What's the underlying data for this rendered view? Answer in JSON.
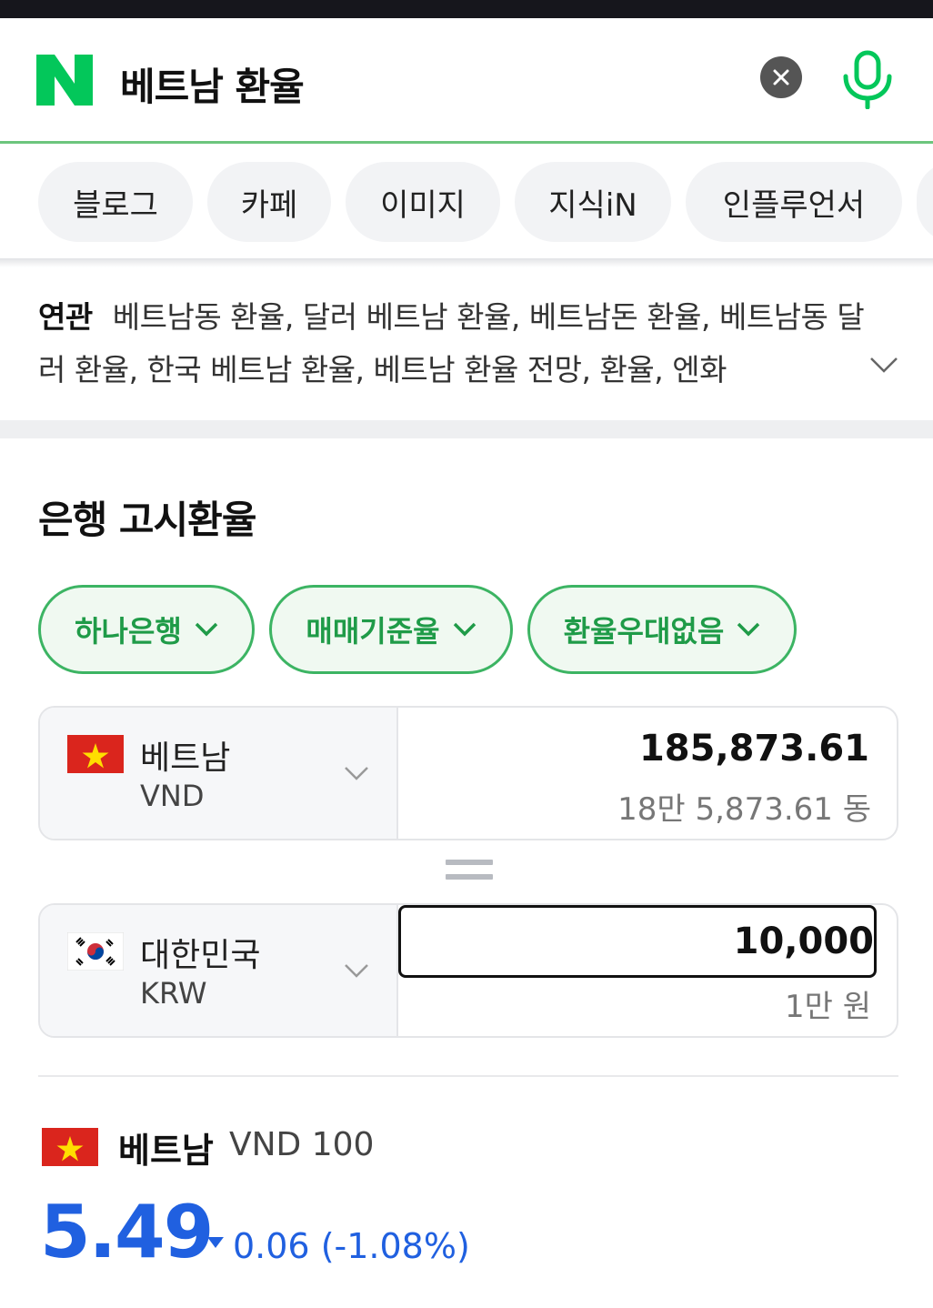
{
  "search": {
    "query": "베트남 환율",
    "clear_icon": "close-icon",
    "mic_icon": "microphone-icon",
    "accent": "#03c75a"
  },
  "tabs": [
    "블로그",
    "카페",
    "이미지",
    "지식iN",
    "인플루언서"
  ],
  "related": {
    "label": "연관",
    "text": "베트남동 환율, 달러 베트남 환율, 베트남돈 환율, 베트남동 달러 환율, 한국 베트남 환율, 베트남 환율 전망, 환율, 엔화"
  },
  "section": {
    "title": "은행 고시환율"
  },
  "filters": [
    "하나은행",
    "매매기준율",
    "환율우대없음"
  ],
  "converter": {
    "from": {
      "name": "베트남",
      "code": "VND",
      "amount": "185,873.61",
      "amount_text": "18만 5,873.61 동"
    },
    "to": {
      "name": "대한민국",
      "code": "KRW",
      "amount": "10,000",
      "amount_text": "1만 원"
    }
  },
  "rate": {
    "name": "베트남",
    "unit": "VND 100",
    "value": "5.49",
    "change": "0.06 (-1.08%)",
    "direction": "down",
    "color": "#2060e0"
  }
}
